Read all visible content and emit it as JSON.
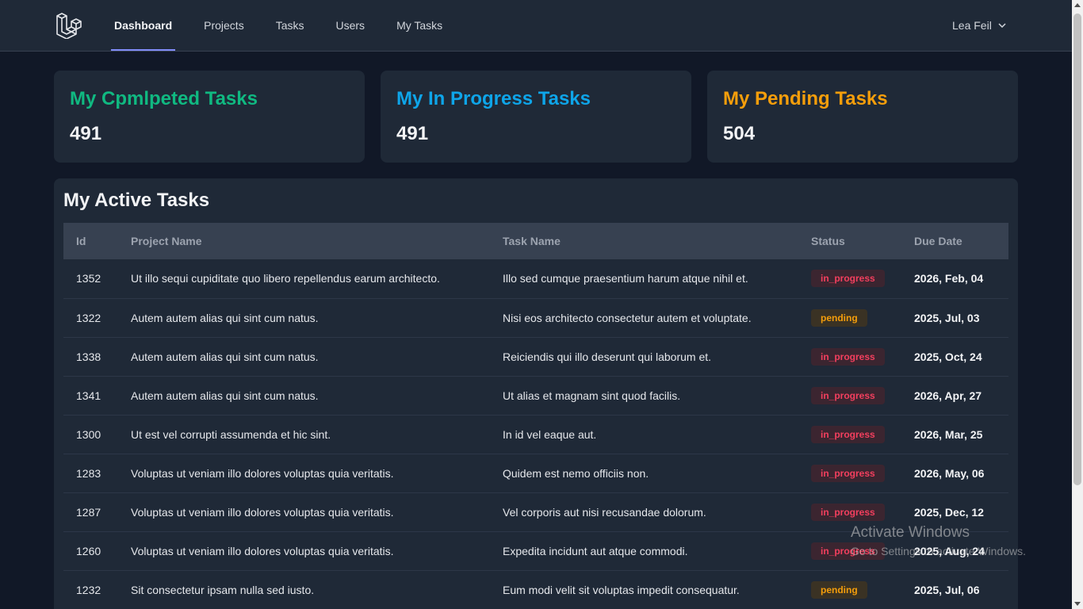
{
  "nav": {
    "links": [
      {
        "label": "Dashboard",
        "active": true
      },
      {
        "label": "Projects",
        "active": false
      },
      {
        "label": "Tasks",
        "active": false
      },
      {
        "label": "Users",
        "active": false
      },
      {
        "label": "My Tasks",
        "active": false
      }
    ],
    "user_name": "Lea Feil",
    "accent_color": "#818cf8"
  },
  "stats": [
    {
      "title": "My Cpmlpeted Tasks",
      "count": "491",
      "color": "#10b981"
    },
    {
      "title": "My In Progress Tasks",
      "count": "491",
      "color": "#0ea5e9"
    },
    {
      "title": "My Pending Tasks",
      "count": "504",
      "color": "#f59e0b"
    }
  ],
  "active_tasks": {
    "title": "My Active Tasks",
    "columns": [
      "Id",
      "Project Name",
      "Task Name",
      "Status",
      "Due Date"
    ],
    "rows": [
      {
        "id": "1352",
        "project": "Ut illo sequi cupiditate quo libero repellendus earum architecto.",
        "task": "Illo sed cumque praesentium harum atque nihil et.",
        "status": "in_progress",
        "due": "2026, Feb, 04"
      },
      {
        "id": "1322",
        "project": "Autem autem alias qui sint cum natus.",
        "task": "Nisi eos architecto consectetur autem et voluptate.",
        "status": "pending",
        "due": "2025, Jul, 03"
      },
      {
        "id": "1338",
        "project": "Autem autem alias qui sint cum natus.",
        "task": "Reiciendis qui illo deserunt qui laborum et.",
        "status": "in_progress",
        "due": "2025, Oct, 24"
      },
      {
        "id": "1341",
        "project": "Autem autem alias qui sint cum natus.",
        "task": "Ut alias et magnam sint quod facilis.",
        "status": "in_progress",
        "due": "2026, Apr, 27"
      },
      {
        "id": "1300",
        "project": "Ut est vel corrupti assumenda et hic sint.",
        "task": "In id vel eaque aut.",
        "status": "in_progress",
        "due": "2026, Mar, 25"
      },
      {
        "id": "1283",
        "project": "Voluptas ut veniam illo dolores voluptas quia veritatis.",
        "task": "Quidem est nemo officiis non.",
        "status": "in_progress",
        "due": "2026, May, 06"
      },
      {
        "id": "1287",
        "project": "Voluptas ut veniam illo dolores voluptas quia veritatis.",
        "task": "Vel corporis aut nisi recusandae dolorum.",
        "status": "in_progress",
        "due": "2025, Dec, 12"
      },
      {
        "id": "1260",
        "project": "Voluptas ut veniam illo dolores voluptas quia veritatis.",
        "task": "Expedita incidunt aut atque commodi.",
        "status": "in_progress",
        "due": "2025, Aug, 24"
      },
      {
        "id": "1232",
        "project": "Sit consectetur ipsam nulla sed iusto.",
        "task": "Eum modi velit sit voluptas impedit consequatur.",
        "status": "pending",
        "due": "2025, Jul, 06"
      }
    ],
    "status_colors": {
      "in_progress": {
        "text": "#f43f5e",
        "bg": "#3b2530"
      },
      "pending": {
        "text": "#f59e0b",
        "bg": "#3a3224"
      }
    }
  },
  "watermark": {
    "line1": "Activate Windows",
    "line2": "Go to Settings to activate Windows."
  }
}
